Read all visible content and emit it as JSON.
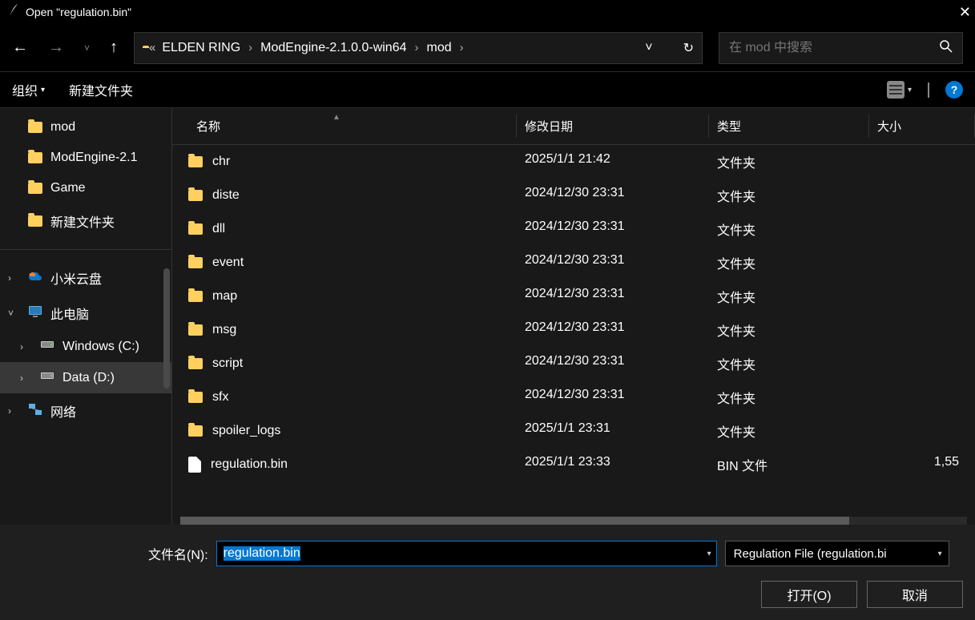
{
  "window": {
    "title": "Open \"regulation.bin\""
  },
  "nav": {
    "breadcrumb": [
      "ELDEN RING",
      "ModEngine-2.1.0.0-win64",
      "mod"
    ],
    "search_placeholder": "在 mod 中搜索"
  },
  "toolbar": {
    "organize": "组织",
    "new_folder": "新建文件夹"
  },
  "sidebar": {
    "folders": [
      {
        "label": "mod"
      },
      {
        "label": "ModEngine-2.1"
      },
      {
        "label": "Game"
      },
      {
        "label": "新建文件夹"
      }
    ],
    "locations": [
      {
        "label": "小米云盘",
        "icon": "cloud",
        "expandable": true,
        "expanded": false,
        "level": 0
      },
      {
        "label": "此电脑",
        "icon": "pc",
        "expandable": true,
        "expanded": true,
        "level": 0
      },
      {
        "label": "Windows (C:)",
        "icon": "disk",
        "expandable": true,
        "expanded": false,
        "level": 1
      },
      {
        "label": "Data (D:)",
        "icon": "disk",
        "expandable": true,
        "expanded": false,
        "level": 1,
        "selected": true
      },
      {
        "label": "网络",
        "icon": "net",
        "expandable": true,
        "expanded": false,
        "level": 0
      }
    ]
  },
  "filelist": {
    "columns": {
      "name": "名称",
      "date": "修改日期",
      "type": "类型",
      "size": "大小"
    },
    "rows": [
      {
        "name": "chr",
        "date": "2025/1/1 21:42",
        "type": "文件夹",
        "kind": "folder",
        "size": ""
      },
      {
        "name": "diste",
        "date": "2024/12/30 23:31",
        "type": "文件夹",
        "kind": "folder",
        "size": ""
      },
      {
        "name": "dll",
        "date": "2024/12/30 23:31",
        "type": "文件夹",
        "kind": "folder",
        "size": ""
      },
      {
        "name": "event",
        "date": "2024/12/30 23:31",
        "type": "文件夹",
        "kind": "folder",
        "size": ""
      },
      {
        "name": "map",
        "date": "2024/12/30 23:31",
        "type": "文件夹",
        "kind": "folder",
        "size": ""
      },
      {
        "name": "msg",
        "date": "2024/12/30 23:31",
        "type": "文件夹",
        "kind": "folder",
        "size": ""
      },
      {
        "name": "script",
        "date": "2024/12/30 23:31",
        "type": "文件夹",
        "kind": "folder",
        "size": ""
      },
      {
        "name": "sfx",
        "date": "2024/12/30 23:31",
        "type": "文件夹",
        "kind": "folder",
        "size": ""
      },
      {
        "name": "spoiler_logs",
        "date": "2025/1/1 23:31",
        "type": "文件夹",
        "kind": "folder",
        "size": ""
      },
      {
        "name": "regulation.bin",
        "date": "2025/1/1 23:33",
        "type": "BIN 文件",
        "kind": "file",
        "size": "1,55"
      }
    ]
  },
  "footer": {
    "filename_label": "文件名(N):",
    "filename_value": "regulation.bin",
    "filter": "Regulation File (regulation.bi",
    "open": "打开(O)",
    "cancel": "取消"
  }
}
